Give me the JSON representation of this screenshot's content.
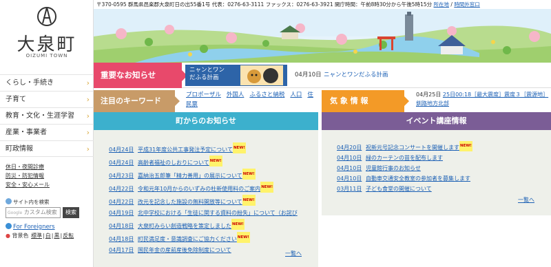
{
  "logo": {
    "name_ja": "大泉町",
    "name_en": "OIZUMI TOWN"
  },
  "topbar": {
    "text": "〒370-0595 群馬県邑楽郡大泉町日の出55番1号 代表：0276-63-3111 ファックス：0276-63-3921 開庁時間：午前8時30分から午後5時15分",
    "link1": "所在地",
    "sep": " / ",
    "link2": "時間外窓口"
  },
  "menu": [
    {
      "label": "くらし・手続き"
    },
    {
      "label": "子育て"
    },
    {
      "label": "教育・文化・生涯学習"
    },
    {
      "label": "産業・事業者"
    },
    {
      "label": "町政情報"
    }
  ],
  "quick_links": [
    "休日・夜間診療",
    "防災・防犯情報",
    "安全・安心メール"
  ],
  "search": {
    "label": "サイト内を検索",
    "brand": "Google",
    "placeholder": "カスタム検索",
    "button": "検索"
  },
  "foreigners_link": "For Foreigners",
  "bgcolor": {
    "label": "背景色",
    "options": [
      "標準",
      "白",
      "黒",
      "反転"
    ]
  },
  "important": {
    "heading": "重要なお知らせ",
    "thumb_text_1": "ニャンとワン",
    "thumb_text_2": "だふる計画",
    "date": "04月10日",
    "text": "ニャンとワンだふる計画"
  },
  "keywords": {
    "heading": "注目のキーワード",
    "items": [
      "プロポーザル",
      "外国人",
      "ふるさと納税",
      "人口",
      "住民票"
    ]
  },
  "weather": {
    "heading": "気 象 情 報",
    "date": "04月25日",
    "link": "25日00:18［最大震度］震度３［震源地］釧路地方北部"
  },
  "news": {
    "heading": "町からのお知らせ",
    "new_badge": "NEW!",
    "items": [
      {
        "date": "04月24日",
        "title": "平成31年度公共工事発注予定について",
        "new": true
      },
      {
        "date": "04月24日",
        "title": "高齢者福祉のしおりについて",
        "new": true
      },
      {
        "date": "04月23日",
        "title": "嘉納治五郎筆「精力善用」の展示について",
        "new": true
      },
      {
        "date": "04月22日",
        "title": "令和元年10月からのいずみの杜新使用料のご案内",
        "new": true
      },
      {
        "date": "04月22日",
        "title": "改元を記念した施設の無料開放等について",
        "new": true
      },
      {
        "date": "04月19日",
        "title": "北中学校における「生徒に関する資料の紛失」について（お詫び",
        "new": false
      },
      {
        "date": "04月18日",
        "title": "大泉町みらい創造戦略を策定しました",
        "new": true
      },
      {
        "date": "04月18日",
        "title": "町民満足度・意識調査にご協力ください",
        "new": true
      },
      {
        "date": "04月17日",
        "title": "国民年金の産前産後免除制度について",
        "new": false
      }
    ],
    "more": "一覧へ"
  },
  "events": {
    "heading": "イベント講座情報",
    "items": [
      {
        "date": "04月20日",
        "title": "祝新元号記念コンサートを開催します",
        "new": true
      },
      {
        "date": "04月10日",
        "title": "緑のカーテンの苗を配布します",
        "new": false
      },
      {
        "date": "04月10日",
        "title": "児童館行事のお知らせ",
        "new": false
      },
      {
        "date": "04月10日",
        "title": "自動車交通安全教室の参加者を募集します",
        "new": false
      },
      {
        "date": "03月11日",
        "title": "子ども食堂の開催について",
        "new": false
      }
    ],
    "more": "一覧へ"
  }
}
